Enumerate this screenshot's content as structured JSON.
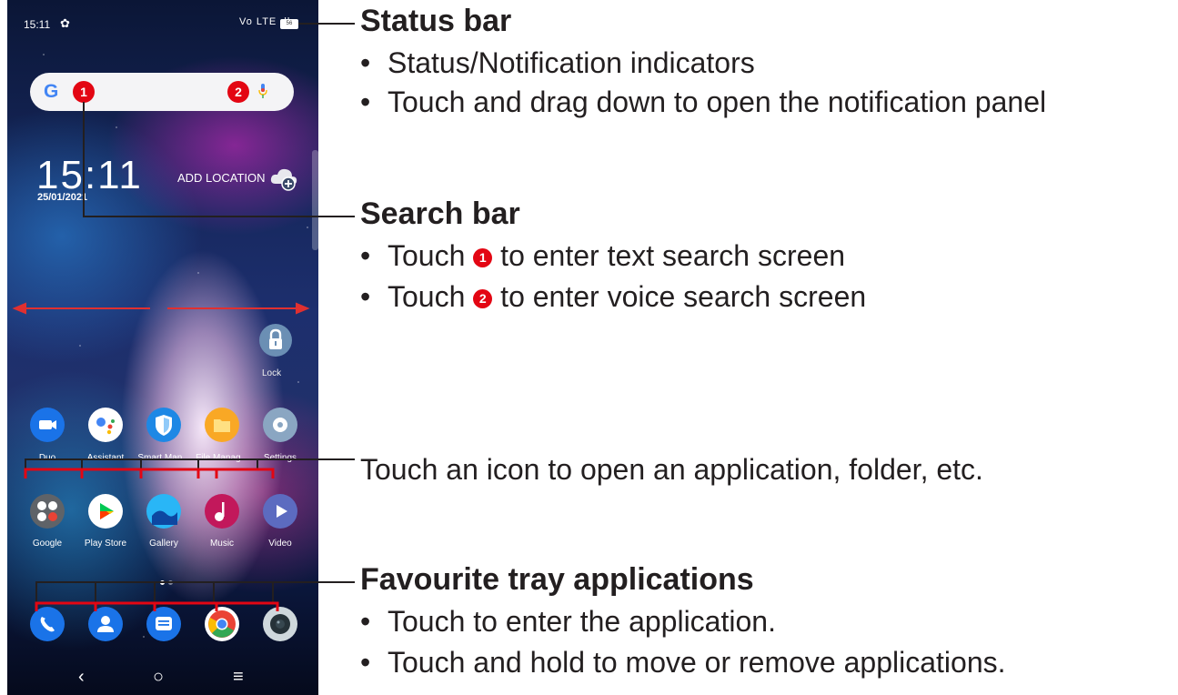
{
  "phone": {
    "status_time": "15:11",
    "network_indicator": "Vo LTE",
    "battery_level": "56",
    "search_logo": "G",
    "callout_1": "1",
    "callout_2": "2",
    "clock_time": "15:11",
    "date": "25/01/2021",
    "add_location": "ADD LOCATION",
    "lock_label": "Lock",
    "apps_row1": [
      "Duo",
      "Assistant",
      "Smart Man...",
      "File Manag...",
      "Settings"
    ],
    "apps_row2": [
      "Google",
      "Play Store",
      "Gallery",
      "Music",
      "Video"
    ],
    "tray_icons": [
      "phone-icon",
      "contacts-icon",
      "messages-icon",
      "chrome-icon",
      "camera-icon"
    ],
    "nav": {
      "back": "‹",
      "home": "○",
      "recents": "≡"
    }
  },
  "annotations": {
    "status_bar": {
      "title": "Status bar",
      "bullets": [
        "Status/Notification indicators",
        "Touch and drag down to open the notification panel"
      ]
    },
    "search_bar": {
      "title": "Search bar",
      "touch": "Touch",
      "bullet1_rest": "to enter text search screen",
      "bullet2_rest": "to enter voice search screen",
      "n1": "1",
      "n2": "2"
    },
    "apps_note": "Touch an icon to open an application, folder, etc.",
    "tray": {
      "title": "Favourite tray applications",
      "bullets": [
        "Touch to enter the application.",
        "Touch and hold to move or remove applications."
      ]
    },
    "bullet_char": "•"
  },
  "colors": {
    "callout_red": "#e30613",
    "text": "#231f20"
  }
}
